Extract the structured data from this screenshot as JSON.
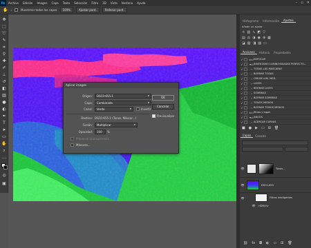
{
  "menubar": {
    "logo": "Ps",
    "items": [
      "Archivo",
      "Edición",
      "Imagen",
      "Capa",
      "Texto",
      "Selección",
      "Filtro",
      "3D",
      "Vista",
      "Ventana",
      "Ayuda"
    ]
  },
  "options": {
    "sample_all_layers": "Muestrear todas las capas",
    "zoom": "100%",
    "fit_screen": "Ajustar pant.",
    "fill_screen": "Rellenar pant."
  },
  "dialog": {
    "title": "Aplicar imagen",
    "source_label": "Origen:",
    "source_value": "DSC0-655-1",
    "layer_label": "Capa:",
    "layer_value": "Combinada",
    "channel_label": "Canal:",
    "channel_value": "Verde",
    "invert_label": "Invertir",
    "target_label": "Destino:",
    "target_value": "DSC0-655-1 (Tonos, Máscar...)",
    "blending_label": "Fusión:",
    "blending_value": "Multiplicar",
    "opacity_label": "Opacidad:",
    "opacity_value": "100",
    "opacity_unit": "%",
    "preserve_transparency": "Preservar transparencia",
    "mask_label": "Máscara...",
    "ok_label": "OK",
    "cancel_label": "Cancelar",
    "preview_label": "Previsualizar"
  },
  "panels": {
    "top_tabs": [
      "Histograma",
      "Información",
      "Ajustes"
    ],
    "add_adjustment": "Añadir un ajuste",
    "actions_tabs": [
      "Acciones",
      "Historia",
      "Propiedades"
    ],
    "actions": [
      {
        "name": "ENFOCAR",
        "folder": true
      },
      {
        "name": "INVENTARIO LUMINOSIDADES PERFECTO...",
        "folder": true
      },
      {
        "name": "TODAS LAS MÁSCARAS",
        "folder": false
      },
      {
        "name": "BORRAR TODAS",
        "folder": false
      },
      {
        "name": "CREAR LUM. MED.",
        "folder": false
      },
      {
        "name": "LUCES",
        "folder": false
      },
      {
        "name": "BORRAR LUCES",
        "folder": false
      },
      {
        "name": "SOMBRAS",
        "folder": false
      },
      {
        "name": "BORRAR SOMBRAS",
        "folder": false
      },
      {
        "name": "TONOS MEDIOS",
        "folder": false
      },
      {
        "name": "BORRAR TONOS MEDIOS",
        "folder": false
      },
      {
        "name": "filtros y logos",
        "folder": true
      },
      {
        "name": "ANUOS",
        "folder": true
      },
      {
        "name": "ACERCAR CURVAS",
        "folder": false
      }
    ],
    "layers_tabs": [
      "Capas",
      "Canales"
    ],
    "layers": [
      {
        "name": "Tonos...",
        "kind": "adjustment"
      },
      {
        "name": "DSC0-655",
        "kind": "image"
      },
      {
        "name": "Filtros inteligentes",
        "kind": "smart-filter"
      },
      {
        "name": "HDR/Viv",
        "kind": "filter"
      }
    ]
  },
  "colors": {
    "ui_dark": "#323232",
    "panel": "#3b3b3b",
    "canvas_blue": "#4a14ff",
    "canvas_green": "#2ee63a",
    "canvas_magenta": "#ff2a8c"
  }
}
